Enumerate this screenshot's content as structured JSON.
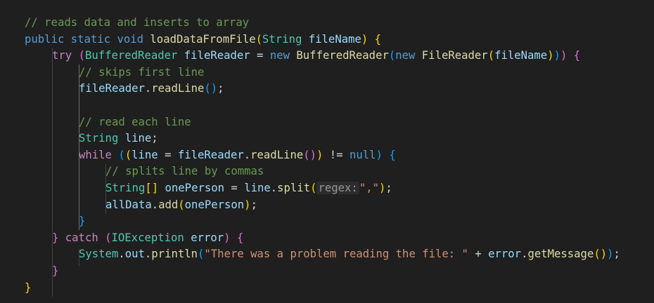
{
  "code_lines": [
    [
      {
        "t": "// reads data and inserts to array",
        "c": "cm"
      }
    ],
    [
      {
        "t": "public",
        "c": "k"
      },
      {
        "t": " ",
        "c": "p"
      },
      {
        "t": "static",
        "c": "k"
      },
      {
        "t": " ",
        "c": "p"
      },
      {
        "t": "void",
        "c": "k"
      },
      {
        "t": " ",
        "c": "p"
      },
      {
        "t": "loadDataFromFile",
        "c": "f"
      },
      {
        "t": "(",
        "c": "b1"
      },
      {
        "t": "String",
        "c": "t"
      },
      {
        "t": " ",
        "c": "p"
      },
      {
        "t": "fileName",
        "c": "v"
      },
      {
        "t": ")",
        "c": "b1"
      },
      {
        "t": " ",
        "c": "p"
      },
      {
        "t": "{",
        "c": "b1"
      }
    ],
    [
      {
        "t": "try",
        "c": "c"
      },
      {
        "t": " ",
        "c": "p"
      },
      {
        "t": "(",
        "c": "b2"
      },
      {
        "t": "BufferedReader",
        "c": "t"
      },
      {
        "t": " ",
        "c": "p"
      },
      {
        "t": "fileReader",
        "c": "v"
      },
      {
        "t": " = ",
        "c": "p"
      },
      {
        "t": "new",
        "c": "k"
      },
      {
        "t": " ",
        "c": "p"
      },
      {
        "t": "BufferedReader",
        "c": "f"
      },
      {
        "t": "(",
        "c": "b3"
      },
      {
        "t": "new",
        "c": "k"
      },
      {
        "t": " ",
        "c": "p"
      },
      {
        "t": "FileReader",
        "c": "f"
      },
      {
        "t": "(",
        "c": "b1"
      },
      {
        "t": "fileName",
        "c": "v"
      },
      {
        "t": ")",
        "c": "b1"
      },
      {
        "t": ")",
        "c": "b3"
      },
      {
        "t": ")",
        "c": "b2"
      },
      {
        "t": " ",
        "c": "p"
      },
      {
        "t": "{",
        "c": "b2"
      }
    ],
    [
      {
        "t": "// skips first line",
        "c": "cm"
      }
    ],
    [
      {
        "t": "fileReader",
        "c": "v"
      },
      {
        "t": ".",
        "c": "p"
      },
      {
        "t": "readLine",
        "c": "f"
      },
      {
        "t": "(",
        "c": "b3"
      },
      {
        "t": ")",
        "c": "b3"
      },
      {
        "t": ";",
        "c": "p"
      }
    ],
    [],
    [
      {
        "t": "// read each line",
        "c": "cm"
      }
    ],
    [
      {
        "t": "String",
        "c": "t"
      },
      {
        "t": " ",
        "c": "p"
      },
      {
        "t": "line",
        "c": "v"
      },
      {
        "t": ";",
        "c": "p"
      }
    ],
    [
      {
        "t": "while",
        "c": "c"
      },
      {
        "t": " ",
        "c": "p"
      },
      {
        "t": "(",
        "c": "b3"
      },
      {
        "t": "(",
        "c": "b1"
      },
      {
        "t": "line",
        "c": "v"
      },
      {
        "t": " = ",
        "c": "p"
      },
      {
        "t": "fileReader",
        "c": "v"
      },
      {
        "t": ".",
        "c": "p"
      },
      {
        "t": "readLine",
        "c": "f"
      },
      {
        "t": "(",
        "c": "b2"
      },
      {
        "t": ")",
        "c": "b2"
      },
      {
        "t": ")",
        "c": "b1"
      },
      {
        "t": " != ",
        "c": "p"
      },
      {
        "t": "null",
        "c": "k"
      },
      {
        "t": ")",
        "c": "b3"
      },
      {
        "t": " ",
        "c": "p"
      },
      {
        "t": "{",
        "c": "b3"
      }
    ],
    [
      {
        "t": "// splits line by commas",
        "c": "cm"
      }
    ],
    [
      {
        "t": "String",
        "c": "t"
      },
      {
        "t": "[",
        "c": "b1"
      },
      {
        "t": "]",
        "c": "b1"
      },
      {
        "t": " ",
        "c": "p"
      },
      {
        "t": "onePerson",
        "c": "v"
      },
      {
        "t": " = ",
        "c": "p"
      },
      {
        "t": "line",
        "c": "v"
      },
      {
        "t": ".",
        "c": "p"
      },
      {
        "t": "split",
        "c": "f"
      },
      {
        "t": "(",
        "c": "b1"
      },
      {
        "t": "regex:",
        "c": "hint"
      },
      {
        "t": "\",\"",
        "c": "s"
      },
      {
        "t": ")",
        "c": "b1"
      },
      {
        "t": ";",
        "c": "p"
      }
    ],
    [
      {
        "t": "allData",
        "c": "v"
      },
      {
        "t": ".",
        "c": "p"
      },
      {
        "t": "add",
        "c": "f"
      },
      {
        "t": "(",
        "c": "b1"
      },
      {
        "t": "onePerson",
        "c": "v"
      },
      {
        "t": ")",
        "c": "b1"
      },
      {
        "t": ";",
        "c": "p"
      }
    ],
    [
      {
        "t": "}",
        "c": "b3"
      }
    ],
    [
      {
        "t": "}",
        "c": "b2"
      },
      {
        "t": " ",
        "c": "p"
      },
      {
        "t": "catch",
        "c": "c"
      },
      {
        "t": " ",
        "c": "p"
      },
      {
        "t": "(",
        "c": "b2"
      },
      {
        "t": "IOException",
        "c": "t"
      },
      {
        "t": " ",
        "c": "p"
      },
      {
        "t": "error",
        "c": "v"
      },
      {
        "t": ")",
        "c": "b2"
      },
      {
        "t": " ",
        "c": "p"
      },
      {
        "t": "{",
        "c": "b2"
      }
    ],
    [
      {
        "t": "System",
        "c": "t"
      },
      {
        "t": ".",
        "c": "p"
      },
      {
        "t": "out",
        "c": "v"
      },
      {
        "t": ".",
        "c": "p"
      },
      {
        "t": "println",
        "c": "f"
      },
      {
        "t": "(",
        "c": "b3"
      },
      {
        "t": "\"There was a problem reading the file: \"",
        "c": "s"
      },
      {
        "t": " + ",
        "c": "p"
      },
      {
        "t": "error",
        "c": "v"
      },
      {
        "t": ".",
        "c": "p"
      },
      {
        "t": "getMessage",
        "c": "f"
      },
      {
        "t": "(",
        "c": "b1"
      },
      {
        "t": ")",
        "c": "b1"
      },
      {
        "t": ")",
        "c": "b3"
      },
      {
        "t": ";",
        "c": "p"
      }
    ],
    [
      {
        "t": "}",
        "c": "b2"
      }
    ],
    [
      {
        "t": "}",
        "c": "b1"
      }
    ]
  ]
}
